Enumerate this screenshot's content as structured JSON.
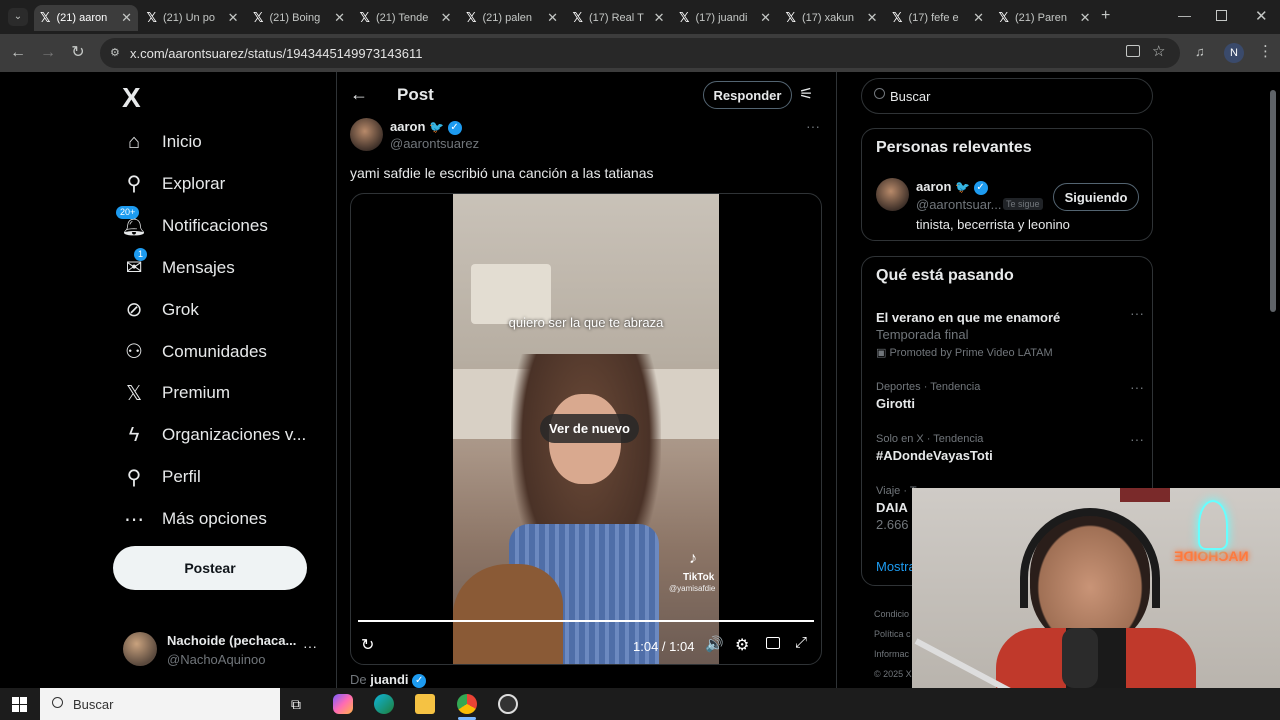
{
  "browser": {
    "tabs": [
      {
        "title": "(21) aaron",
        "active": true
      },
      {
        "title": "(21) Un po",
        "active": false
      },
      {
        "title": "(21) Boing",
        "active": false
      },
      {
        "title": "(21) Tende",
        "active": false
      },
      {
        "title": "(21) palen",
        "active": false
      },
      {
        "title": "(17) Real T",
        "active": false
      },
      {
        "title": "(17) juandi",
        "active": false
      },
      {
        "title": "(17) xakun",
        "active": false
      },
      {
        "title": "(17) fefe e",
        "active": false
      },
      {
        "title": "(21) Paren",
        "active": false
      }
    ],
    "url": "x.com/aarontsuarez/status/1943445149973143611",
    "profile_initial": "N"
  },
  "sidebar": {
    "logo": "X",
    "items": [
      {
        "label": "Inicio",
        "icon": "home-icon"
      },
      {
        "label": "Explorar",
        "icon": "search-icon"
      },
      {
        "label": "Notificaciones",
        "icon": "bell-icon",
        "badge": "20+"
      },
      {
        "label": "Mensajes",
        "icon": "mail-icon",
        "badge": "1"
      },
      {
        "label": "Grok",
        "icon": "grok-icon"
      },
      {
        "label": "Comunidades",
        "icon": "people-icon"
      },
      {
        "label": "Premium",
        "icon": "x-logo-icon"
      },
      {
        "label": "Organizaciones v...",
        "icon": "lightning-icon"
      },
      {
        "label": "Perfil",
        "icon": "person-icon"
      },
      {
        "label": "Más opciones",
        "icon": "more-circle-icon"
      }
    ],
    "post_button": "Postear",
    "account": {
      "name": "Nachoide (pechaca...",
      "handle": "@NachoAquinoo"
    }
  },
  "post": {
    "header_title": "Post",
    "reply_button": "Responder",
    "author_name": "aaron",
    "author_handle": "@aarontsuarez",
    "text": "yami safdie le escribió una canción a las tatianas",
    "video": {
      "caption": "quiero ser la que te abraza",
      "replay_label": "Ver de nuevo",
      "watermark": "TikTok",
      "watermark_user": "@yamisafdie",
      "time": "1:04 / 1:04",
      "progress": 1.0
    },
    "from_prefix": "De",
    "from_user": "juandi"
  },
  "right": {
    "search_placeholder": "Buscar",
    "relevant": {
      "title": "Personas relevantes",
      "name": "aaron",
      "handle": "@aarontsuar...",
      "follows_you": "Te sigue",
      "bio": "tinista, becerrista y leonino",
      "follow_button": "Siguiendo"
    },
    "trending": {
      "title": "Qué está pasando",
      "items": [
        {
          "meta": "",
          "name": "El verano en que me enamoré",
          "sub": "Temporada final",
          "promo": "Promoted by Prime Video LATAM"
        },
        {
          "meta": "Deportes · Tendencia",
          "name": "Girotti",
          "sub": "",
          "promo": ""
        },
        {
          "meta": "Solo en X · Tendencia",
          "name": "#ADondeVayasToti",
          "sub": "",
          "promo": ""
        },
        {
          "meta": "Viaje · T",
          "name": "DAIA",
          "sub": "2.666 p",
          "promo": ""
        }
      ],
      "show_more": "Mostra"
    },
    "footer": [
      "Condicio",
      "Política c",
      "Informac",
      "© 2025 X"
    ]
  },
  "webcam": {
    "neon_text": "NACHOIDE"
  },
  "taskbar": {
    "search_placeholder": "Buscar"
  }
}
